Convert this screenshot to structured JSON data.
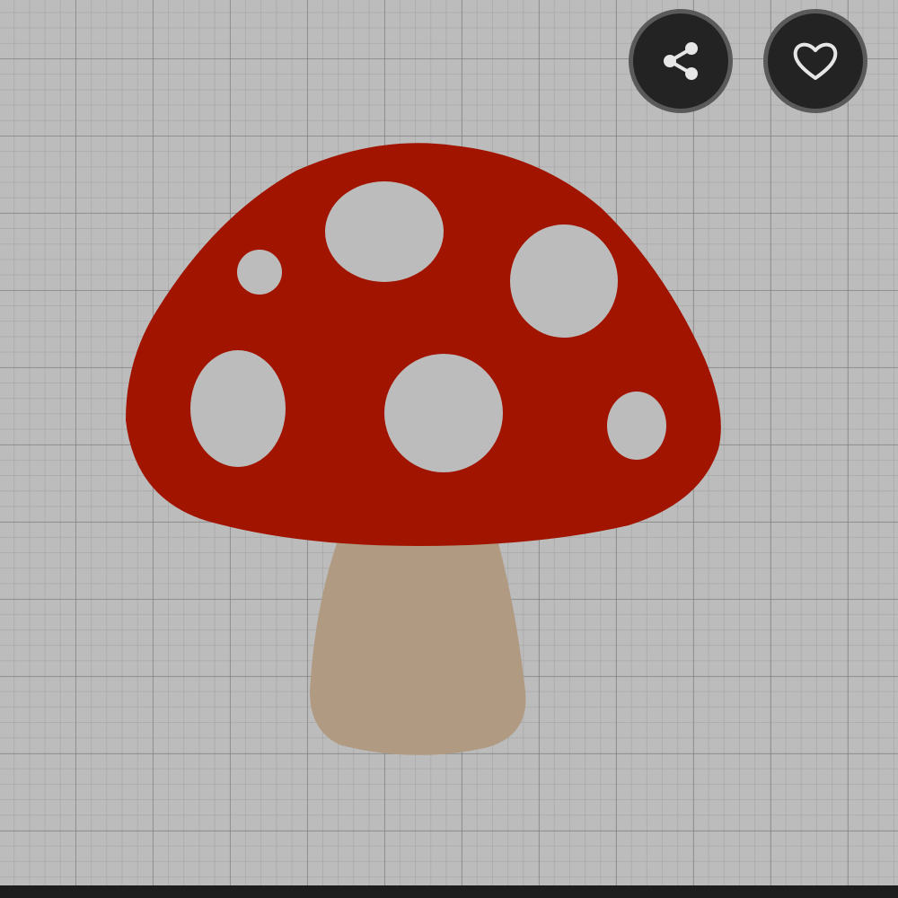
{
  "canvas": {
    "background": "#bcbcbc",
    "grid_color": "#8a8a8a"
  },
  "artwork": {
    "subject": "mushroom-illustration",
    "cap_color": "#a11400",
    "spot_color": "#bcbcbc",
    "stem_color": "#b09a82"
  },
  "actions": {
    "share_icon": "share-icon",
    "like_icon": "heart-icon",
    "button_color": "#232323",
    "icon_color": "#e6e6e6"
  }
}
